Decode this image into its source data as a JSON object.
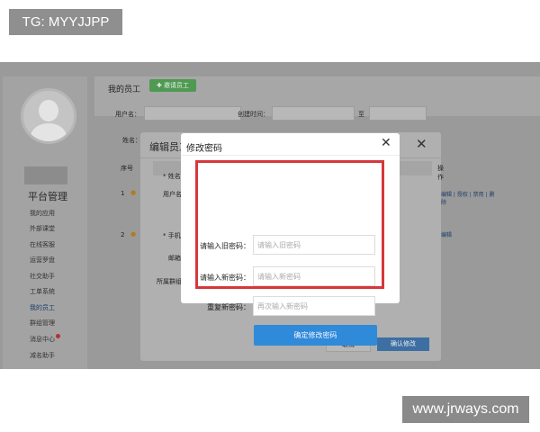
{
  "overlay": {
    "tg_label": "TG: MYYJJPP",
    "watermark": "www.jrways.com"
  },
  "sidebar": {
    "title": "平台管理",
    "items": [
      "我的应用",
      "外部课堂",
      "在线客服",
      "运营罗盘",
      "社交助手",
      "工单系统",
      "我的员工",
      "群组管理",
      "消息中心",
      "减名助手"
    ]
  },
  "main": {
    "title": "我的员工",
    "invite_button": "邀请员工",
    "filters": {
      "username_label": "用户名：",
      "created_label": "创建时间：",
      "to_label": "至",
      "name_label": "姓名："
    },
    "table": {
      "seq_header": "序号",
      "op_header": "操作",
      "rows": [
        {
          "seq": "1",
          "ops": "编辑 | 授权 | 禁用 | 删除"
        },
        {
          "seq": "2",
          "ops": "编辑"
        }
      ]
    }
  },
  "edit_modal": {
    "title": "编辑员工",
    "fields": {
      "name": "* 姓名",
      "username": "用户名",
      "phone": "* 手机",
      "email": "邮箱",
      "group": "所属群组"
    },
    "cancel": "取消",
    "confirm": "确认修改"
  },
  "password_modal": {
    "title": "修改密码",
    "old_label": "请输入旧密码：",
    "old_placeholder": "请输入旧密码",
    "new_label": "请输入新密码：",
    "new_placeholder": "请输入新密码",
    "repeat_label": "重复新密码：",
    "repeat_placeholder": "再次输入新密码",
    "submit": "确定修改密码",
    "highlight_color": "#d6373c",
    "accent_color": "#2f8ad9"
  }
}
